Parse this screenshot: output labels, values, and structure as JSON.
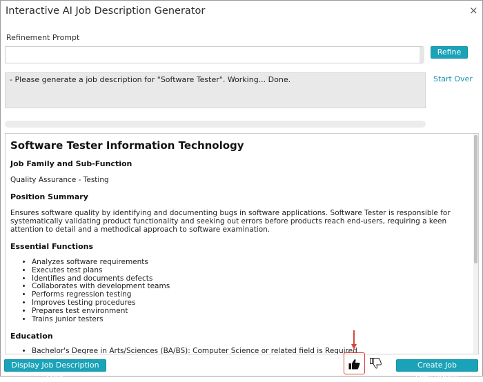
{
  "window": {
    "title": "Interactive AI Job Description Generator",
    "close_glyph": "×"
  },
  "refine": {
    "label": "Refinement Prompt",
    "value": "",
    "button_label": "Refine",
    "start_over": "Start Over"
  },
  "log": {
    "text": "- Please generate a job description for \"Software Tester\". Working... Done."
  },
  "document": {
    "title": "Software Tester Information Technology",
    "sections": {
      "family_heading": "Job Family and Sub-Function",
      "family_text": "Quality Assurance - Testing",
      "summary_heading": "Position Summary",
      "summary_text": "Ensures software quality by identifying and documenting bugs in software applications. Software Tester is responsible for systematically validating product functionality and seeking out errors before products reach end-users, requiring a keen attention to detail and a methodical approach to software examination.",
      "essential_heading": "Essential Functions",
      "essential_items": [
        "Analyzes software requirements",
        "Executes test plans",
        "Identifies and documents defects",
        "Collaborates with development teams",
        "Performs regression testing",
        "Improves testing procedures",
        "Prepares test environment",
        "Trains junior testers"
      ],
      "education_heading": "Education",
      "education_items": [
        "Bachelor's Degree in Arts/Sciences (BA/BS): Computer Science or related field is Required"
      ]
    }
  },
  "footer": {
    "logs_button": "Display Job Description Logs",
    "create_button": "Create Job Description",
    "thumbs_up_icon": "thumbs-up-icon",
    "thumbs_down_icon": "thumbs-down-icon"
  },
  "colors": {
    "accent": "#1aa3b8",
    "highlight": "#d9453c"
  }
}
